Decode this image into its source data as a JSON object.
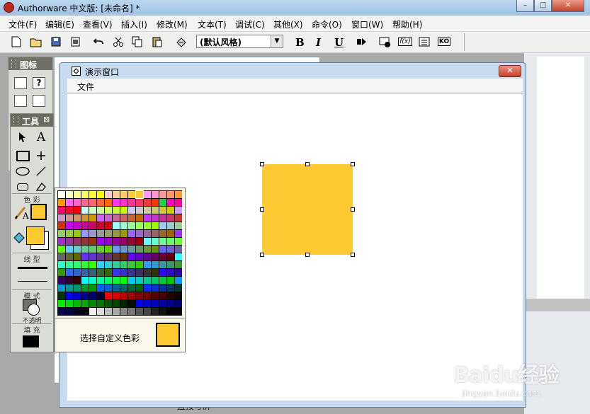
{
  "window": {
    "title": "Authorware 中文版: [未命名] *",
    "minimize_glyph": "–",
    "maximize_glyph": "□",
    "close_glyph": "✕"
  },
  "menu": [
    "文件(F)",
    "编辑(E)",
    "查看(V)",
    "插入(I)",
    "修改(M)",
    "文本(T)",
    "调试(C)",
    "其他(X)",
    "命令(O)",
    "窗口(W)",
    "帮助(H)"
  ],
  "toolbar": {
    "style_select_value": "(默认风格)",
    "bold_label": "B",
    "italic_label": "I",
    "underline_label": "U",
    "fn_label": "f(x)",
    "ko_label": "KO",
    "icons": [
      "new-icon",
      "open-icon",
      "save-all-icon",
      "import-icon",
      "undo-icon",
      "cut-icon",
      "copy-icon",
      "paste-icon",
      "find-icon",
      "run-icon",
      "control-panel-icon",
      "functions-icon",
      "variables-icon",
      "knowledge-objects-icon"
    ]
  },
  "icon_palette": {
    "title": "图标"
  },
  "tool_palette": {
    "title": "工具",
    "color_label": "色 彩",
    "line_label": "线 型",
    "mode_label": "模 式",
    "mode_value": "不透明",
    "fill_label": "填 充",
    "fill_color": "#ffc933",
    "line_color_swatch": "#ffc933"
  },
  "demo_window": {
    "title": "演示窗口",
    "menu_file": "文件",
    "close_glyph": "✕"
  },
  "selected_shape": {
    "type": "rectangle",
    "fill_color": "#ffc933"
  },
  "color_picker": {
    "custom_label": "选择自定义色彩",
    "current_color": "#ffc933",
    "swatches": [
      [
        "#ffffff",
        "#ffffcc",
        "#ffff99",
        "#ffff66",
        "#ffff33",
        "#ffff00",
        "#ffcccc",
        "#ffcc99",
        "#ffcc66",
        "#ffcc33",
        "#ffc933",
        "#ff99ff",
        "#ff99cc",
        "#ff9999",
        "#ff9966",
        "#ff9933"
      ],
      [
        "#ff9900",
        "#ff66ff",
        "#ff66cc",
        "#ff6699",
        "#ff6666",
        "#ff6633",
        "#ff6600",
        "#ff33ff",
        "#ff33cc",
        "#ff3399",
        "#ff3366",
        "#ff3333",
        "#ff3300",
        "#22cc44",
        "#ff00cc",
        "#ff0099"
      ],
      [
        "#ff0066",
        "#ff0033",
        "#ff0000",
        "#ccffff",
        "#ccffcc",
        "#ccff99",
        "#ccff66",
        "#ccff33",
        "#ccff00",
        "#ccccff",
        "#cccccc",
        "#cccc99",
        "#cccc66",
        "#cccc33",
        "#cccc00",
        "#cc99ff"
      ],
      [
        "#cc99cc",
        "#cc9999",
        "#cc9966",
        "#cc9933",
        "#cc9900",
        "#cc66ff",
        "#cc66cc",
        "#cc6699",
        "#cc6666",
        "#cc6633",
        "#cc6600",
        "#cc33ff",
        "#cc33cc",
        "#cc3399",
        "#cc3366",
        "#cc3333"
      ],
      [
        "#cc3300",
        "#cc00ff",
        "#cc00cc",
        "#cc0099",
        "#cc0066",
        "#cc0033",
        "#cc0000",
        "#99ffff",
        "#99ffcc",
        "#99ff99",
        "#99ff66",
        "#99ff33",
        "#99ff00",
        "#99ccff",
        "#99cccc",
        "#99cc99"
      ],
      [
        "#99cc66",
        "#99cc33",
        "#99cc00",
        "#9999ff",
        "#9999cc",
        "#999999",
        "#999966",
        "#999933",
        "#999900",
        "#9966ff",
        "#9966cc",
        "#996699",
        "#996666",
        "#996633",
        "#996600",
        "#9933ff"
      ],
      [
        "#9933cc",
        "#993399",
        "#993366",
        "#993333",
        "#993300",
        "#9900ff",
        "#9900cc",
        "#990099",
        "#990066",
        "#990033",
        "#990000",
        "#66ffff",
        "#66ffcc",
        "#66ff99",
        "#66ff66",
        "#66ff33"
      ],
      [
        "#66ff00",
        "#66ccff",
        "#66cccc",
        "#66cc99",
        "#66cc66",
        "#66cc33",
        "#66cc00",
        "#6699ff",
        "#6699cc",
        "#669999",
        "#669966",
        "#669933",
        "#669900",
        "#6666ff",
        "#6666cc",
        "#666699"
      ],
      [
        "#666666",
        "#666633",
        "#666600",
        "#6633ff",
        "#6633cc",
        "#663399",
        "#663366",
        "#663333",
        "#663300",
        "#6600ff",
        "#6600cc",
        "#660099",
        "#660066",
        "#660033",
        "#660000",
        "#33ffff"
      ],
      [
        "#33ffcc",
        "#33ff99",
        "#33ff66",
        "#33ff33",
        "#33ff00",
        "#33ccff",
        "#33cccc",
        "#33cc99",
        "#33cc66",
        "#33cc33",
        "#33cc00",
        "#3399ff",
        "#3399cc",
        "#339999",
        "#339966",
        "#339933"
      ],
      [
        "#339900",
        "#3366ff",
        "#3366cc",
        "#336699",
        "#336666",
        "#336633",
        "#336600",
        "#3333ff",
        "#3333cc",
        "#333399",
        "#333366",
        "#333333",
        "#333300",
        "#3300ff",
        "#3300cc",
        "#330099"
      ],
      [
        "#330066",
        "#330033",
        "#330000",
        "#00ffff",
        "#00ffcc",
        "#00ff99",
        "#00ff66",
        "#00ff33",
        "#00ff00",
        "#00ccff",
        "#00cccc",
        "#00cc99",
        "#00cc66",
        "#00cc33",
        "#00cc00",
        "#0099ff"
      ],
      [
        "#0099cc",
        "#009999",
        "#009966",
        "#009933",
        "#009900",
        "#0066ff",
        "#0066cc",
        "#006699",
        "#006666",
        "#006633",
        "#006600",
        "#0033ff",
        "#0033cc",
        "#003399",
        "#003366",
        "#003333"
      ],
      [
        "#003300",
        "#0000ff",
        "#0000cc",
        "#000099",
        "#000066",
        "#000033",
        "#ee0000",
        "#dd0000",
        "#bb0000",
        "#aa0000",
        "#880000",
        "#770000",
        "#550000",
        "#440000",
        "#220000",
        "#110000"
      ],
      [
        "#00ee00",
        "#00dd00",
        "#00bb00",
        "#00aa00",
        "#008800",
        "#007700",
        "#005500",
        "#004400",
        "#002200",
        "#001100",
        "#0000ee",
        "#0000dd",
        "#0000bb",
        "#0000aa",
        "#000088",
        "#000077"
      ],
      [
        "#000055",
        "#000044",
        "#000022",
        "#000011",
        "#eeeeee",
        "#dddddd",
        "#bbbbbb",
        "#aaaaaa",
        "#888888",
        "#777777",
        "#555555",
        "#444444",
        "#222222",
        "#111111",
        "#000000",
        "#000000"
      ]
    ]
  },
  "watermark": {
    "main": "Baidu经验",
    "sub": "jingyan.baidu.com"
  },
  "background_text": "直接写屏"
}
